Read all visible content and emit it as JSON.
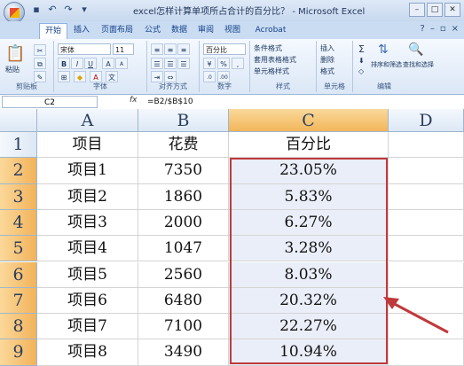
{
  "window": {
    "title": "excel怎样计算单项所占合计的百分比？ - Microsoft Excel",
    "controls": [
      "–",
      "□",
      "✕"
    ]
  },
  "qat": [
    "save-icon",
    "undo-icon",
    "redo-icon",
    "dropdown-icon"
  ],
  "tabs": [
    "开始",
    "插入",
    "页面布局",
    "公式",
    "数据",
    "审阅",
    "视图",
    "Acrobat"
  ],
  "active_tab": "开始",
  "ribbon": {
    "clipboard": {
      "paste": "粘贴",
      "label": "剪贴板"
    },
    "font": {
      "name": "宋体",
      "size": "11",
      "bold": "B",
      "italic": "I",
      "underline": "U",
      "grow": "A",
      "shrink": "A",
      "color": "A",
      "label": "字体"
    },
    "align": {
      "label": "对齐方式"
    },
    "number": {
      "format": "百分比",
      "percent": "%",
      "comma": ",",
      "label": "数字"
    },
    "styles": {
      "cond": "条件格式",
      "table": "套用表格格式",
      "cell": "单元格样式",
      "label": "样式"
    },
    "cells": {
      "insert": "插入",
      "delete": "删除",
      "format": "格式",
      "label": "单元格"
    },
    "editing": {
      "sum": "Σ",
      "sort": "排序和筛选",
      "find": "查找和选择",
      "label": "编辑"
    }
  },
  "formula_bar": {
    "name_box": "C2",
    "fx": "fx",
    "formula": "=B2/$B$10"
  },
  "columns": [
    "A",
    "B",
    "C",
    "D"
  ],
  "rows": [
    {
      "num": "1",
      "a": "项目",
      "b": "花费",
      "c": "百分比"
    },
    {
      "num": "2",
      "a": "项目1",
      "b": "7350",
      "c": "23.05%"
    },
    {
      "num": "3",
      "a": "项目2",
      "b": "1860",
      "c": "5.83%"
    },
    {
      "num": "4",
      "a": "项目3",
      "b": "2000",
      "c": "6.27%"
    },
    {
      "num": "5",
      "a": "项目4",
      "b": "1047",
      "c": "3.28%"
    },
    {
      "num": "6",
      "a": "项目5",
      "b": "2560",
      "c": "8.03%"
    },
    {
      "num": "7",
      "a": "项目6",
      "b": "6480",
      "c": "20.32%"
    },
    {
      "num": "8",
      "a": "项目7",
      "b": "7100",
      "c": "22.27%"
    },
    {
      "num": "9",
      "a": "项目8",
      "b": "3490",
      "c": "10.94%"
    }
  ],
  "colors": {
    "selection_border": "#c0393b",
    "header_selected": "#f3b65a",
    "selected_fill": "#eaeef8",
    "arrow": "#c0393b"
  }
}
